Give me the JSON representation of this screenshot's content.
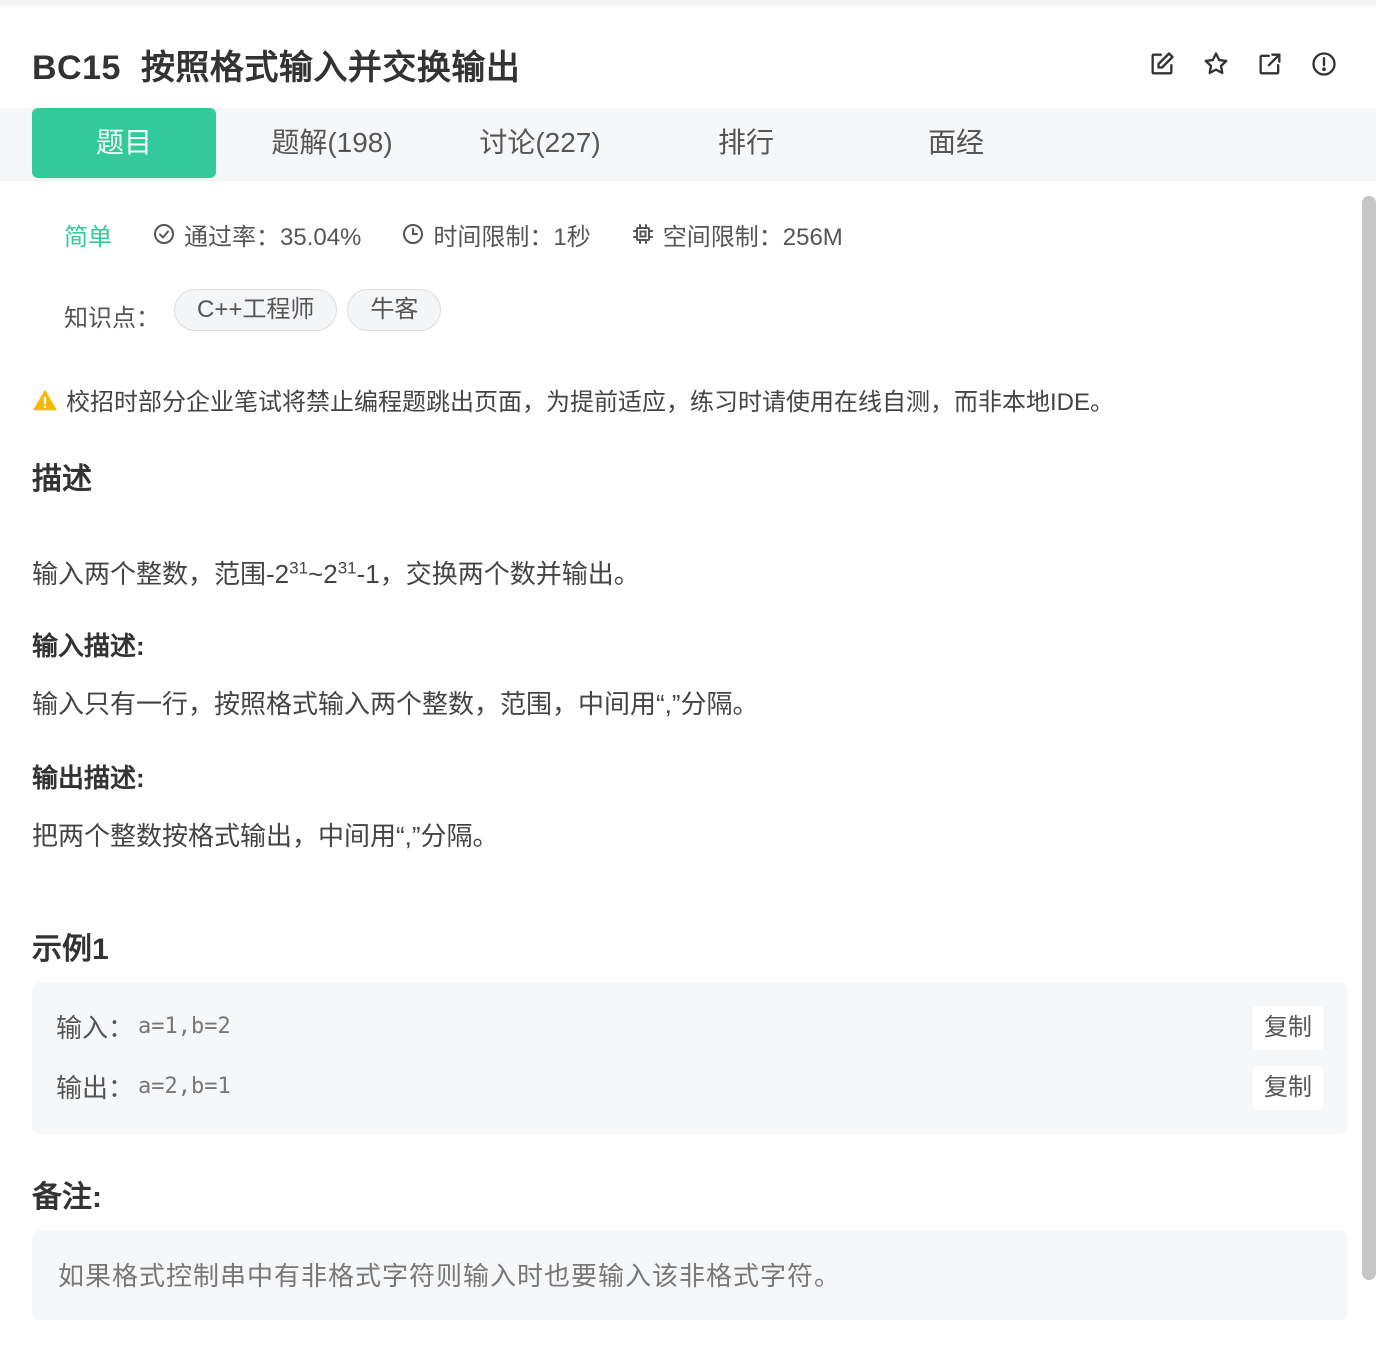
{
  "header": {
    "problem_id": "BC15",
    "title": "按照格式输入并交换输出",
    "icons": [
      "edit-icon",
      "star-icon",
      "external-link-icon",
      "report-icon"
    ]
  },
  "tabs": [
    {
      "label": "题目",
      "active": true
    },
    {
      "label": "题解(198)"
    },
    {
      "label": "讨论(227)"
    },
    {
      "label": "排行"
    },
    {
      "label": "面经"
    }
  ],
  "meta": {
    "difficulty": "简单",
    "pass_rate": "通过率：35.04%",
    "time_limit": "时间限制：1秒",
    "space_limit": "空间限制：256M"
  },
  "knowledge": {
    "label": "知识点：",
    "tags": [
      "C++工程师",
      "牛客"
    ]
  },
  "notice": "校招时部分企业笔试将禁止编程题跳出页面，为提前适应，练习时请使用在线自测，而非本地IDE。",
  "description": {
    "heading": "描述",
    "text_prefix": "输入两个整数，范围-2",
    "exp1": "31",
    "text_mid": "~2",
    "exp2": "31",
    "text_suffix": "-1，交换两个数并输出。"
  },
  "input_desc": {
    "heading": "输入描述:",
    "text": "输入只有一行，按照格式输入两个整数，范围，中间用“,”分隔。"
  },
  "output_desc": {
    "heading": "输出描述:",
    "text": "把两个整数按格式输出，中间用“,”分隔。"
  },
  "example": {
    "heading": "示例1",
    "input_label": "输入：",
    "input_value": "a=1,b=2",
    "output_label": "输出：",
    "output_value": "a=2,b=1",
    "copy_label": "复制"
  },
  "remark": {
    "heading": "备注:",
    "text": "如果格式控制串中有非格式字符则输入时也要输入该非格式字符。"
  },
  "colors": {
    "accent": "#32ca99",
    "warning": "#f5b700"
  }
}
